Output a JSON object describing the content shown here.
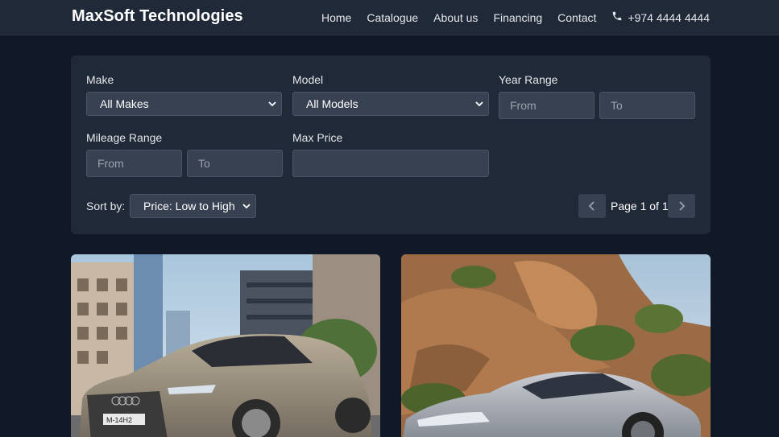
{
  "header": {
    "brand": "MaxSoft Technologies",
    "nav": [
      "Home",
      "Catalogue",
      "About us",
      "Financing",
      "Contact"
    ],
    "phone": "+974 4444 4444",
    "phone_icon": "phone-icon"
  },
  "filters": {
    "make_label": "Make",
    "make_value": "All Makes",
    "model_label": "Model",
    "model_value": "All Models",
    "year_label": "Year Range",
    "year_from_placeholder": "From",
    "year_to_placeholder": "To",
    "mileage_label": "Mileage Range",
    "mileage_from_placeholder": "From",
    "mileage_to_placeholder": "To",
    "max_price_label": "Max Price",
    "max_price_value": "",
    "sort_label": "Sort by:",
    "sort_value": "Price: Low to High"
  },
  "pagination": {
    "text": "Page 1 of 1",
    "prev_icon": "chevron-left-icon",
    "next_icon": "chevron-right-icon"
  },
  "listings": [
    {
      "image": "silver-sedan-city-photo",
      "plate": "M-14H2"
    },
    {
      "image": "silver-ev-rocky-hillside-photo"
    }
  ],
  "colors": {
    "page_bg": "#111827",
    "panel_bg": "#1f2937",
    "field_bg": "#374151",
    "field_border": "#4b5563",
    "text": "#e5e7eb",
    "muted": "#9ca3af"
  }
}
